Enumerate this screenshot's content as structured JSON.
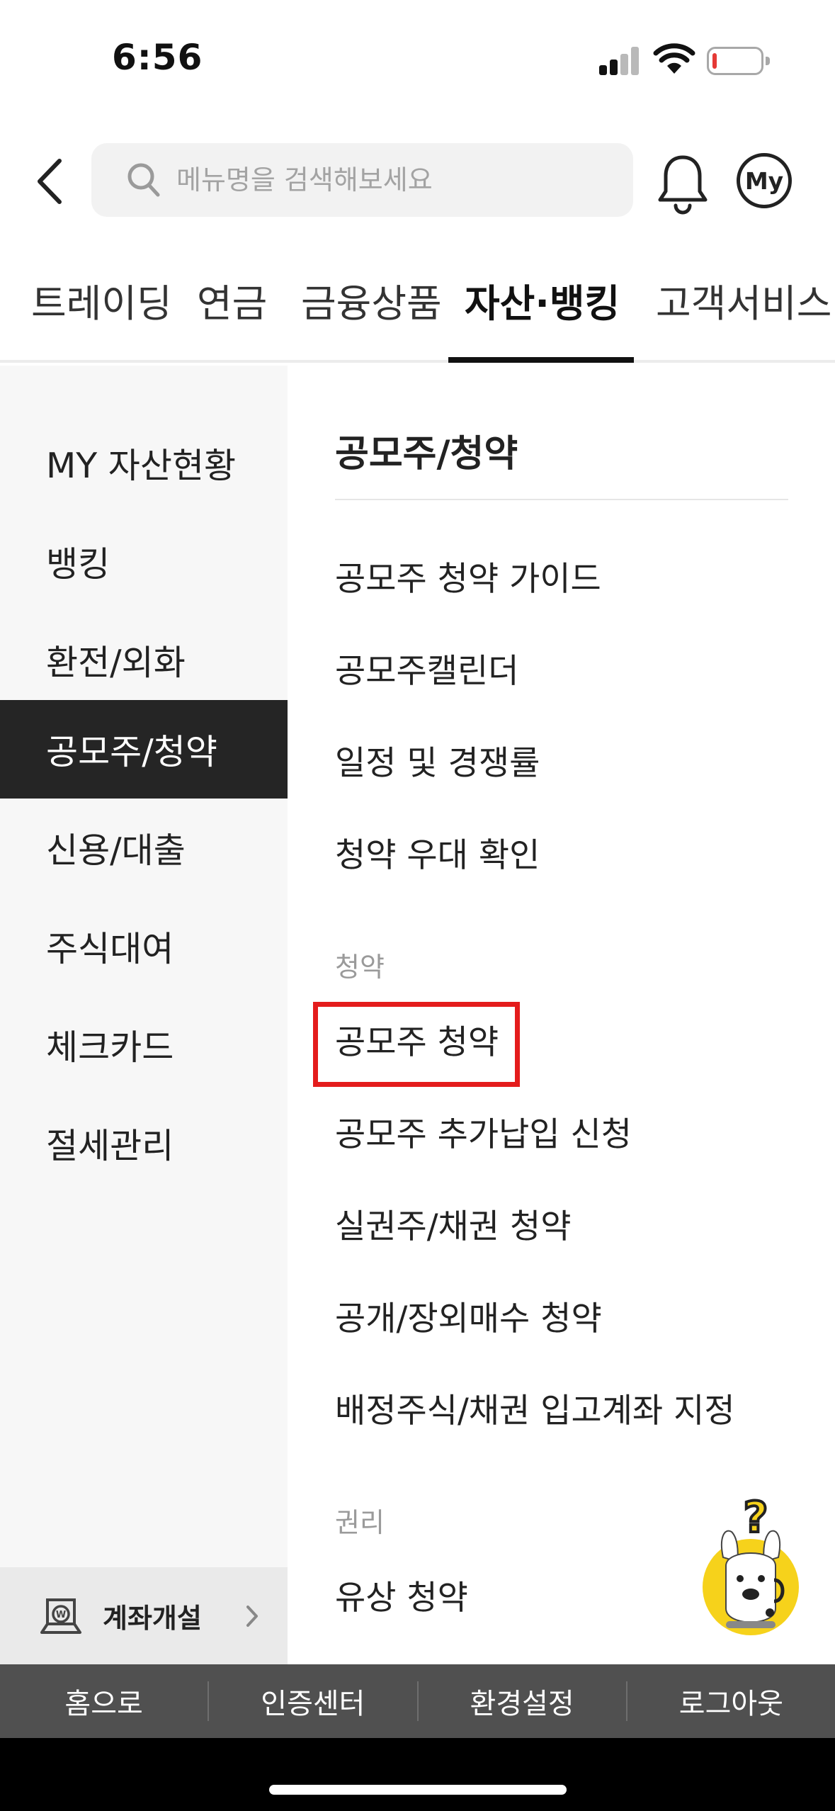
{
  "status_bar": {
    "time": "6:56"
  },
  "search": {
    "placeholder": "메뉴명을 검색해보세요"
  },
  "header": {
    "my_label": "My"
  },
  "top_tabs": [
    {
      "label": "트레이딩",
      "active": false
    },
    {
      "label": "연금",
      "active": false
    },
    {
      "label": "금융상품",
      "active": false
    },
    {
      "label": "자산·뱅킹",
      "active": true
    },
    {
      "label": "고객서비스",
      "active": false
    }
  ],
  "sidebar": {
    "items": [
      {
        "label": "MY 자산현황",
        "active": false
      },
      {
        "label": "뱅킹",
        "active": false
      },
      {
        "label": "환전/외화",
        "active": false
      },
      {
        "label": "공모주/청약",
        "active": true
      },
      {
        "label": "신용/대출",
        "active": false
      },
      {
        "label": "주식대여",
        "active": false
      },
      {
        "label": "체크카드",
        "active": false
      },
      {
        "label": "절세관리",
        "active": false
      }
    ],
    "account_open": {
      "label": "계좌개설",
      "icon": "account-open-icon"
    }
  },
  "content": {
    "title": "공모주/청약",
    "items_top": [
      "공모주 청약 가이드",
      "공모주캘린더",
      "일정 및 경쟁률",
      "청약 우대 확인"
    ],
    "group_subscription": {
      "label": "청약",
      "items": [
        "공모주 청약",
        "공모주 추가납입 신청",
        "실권주/채권 청약",
        "공개/장외매수 청약",
        "배정주식/채권 입고계좌 지정"
      ]
    },
    "group_rights": {
      "label": "권리",
      "items": [
        "유상 청약"
      ]
    },
    "highlighted_item": "공모주 청약"
  },
  "bottom_bar": {
    "items": [
      "홈으로",
      "인증센터",
      "환경설정",
      "로그아웃"
    ]
  },
  "colors": {
    "active_sidebar_bg": "#252525",
    "highlight_border": "#e41c1c",
    "bottom_bar_bg": "#505050",
    "mascot_yellow": "#f6d21b"
  }
}
